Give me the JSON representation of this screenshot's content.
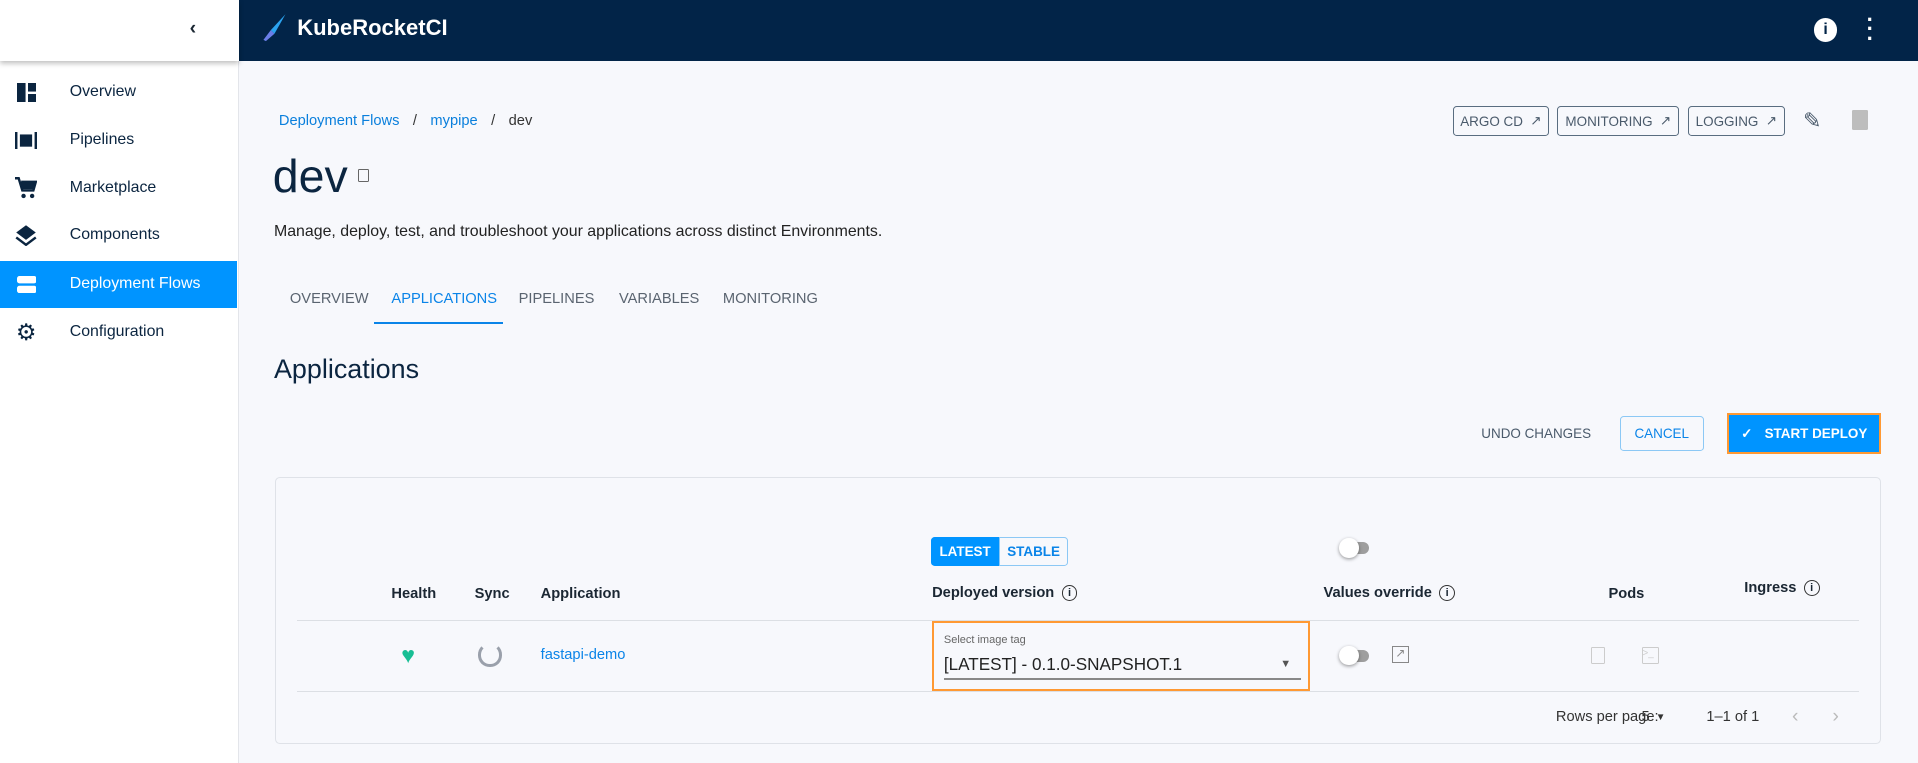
{
  "app": {
    "title": "KubeRocketCI"
  },
  "sidebar": {
    "items": [
      {
        "label": "Overview"
      },
      {
        "label": "Pipelines"
      },
      {
        "label": "Marketplace"
      },
      {
        "label": "Components"
      },
      {
        "label": "Deployment Flows",
        "active": true
      },
      {
        "label": "Configuration"
      }
    ]
  },
  "breadcrumb": [
    "Deployment Flows",
    "mypipe",
    "dev"
  ],
  "actions": {
    "argo": "ARGO CD",
    "monitoring": "MONITORING",
    "logging": "LOGGING"
  },
  "page": {
    "title": "dev",
    "description": "Manage, deploy, test, and troubleshoot your applications across distinct Environments."
  },
  "tabs": [
    "OVERVIEW",
    "APPLICATIONS",
    "PIPELINES",
    "VARIABLES",
    "MONITORING"
  ],
  "section": {
    "title": "Applications",
    "undo": "UNDO CHANGES",
    "cancel": "CANCEL",
    "deploy": "START DEPLOY"
  },
  "table": {
    "toggle": {
      "latest": "LATEST",
      "stable": "STABLE"
    },
    "headers": {
      "health": "Health",
      "sync": "Sync",
      "application": "Application",
      "deployed": "Deployed version",
      "values": "Values override",
      "pods": "Pods",
      "ingress": "Ingress"
    },
    "rows": [
      {
        "application": "fastapi-demo",
        "select_label": "Select image tag",
        "select_value": "[LATEST] - 0.1.0-SNAPSHOT.1"
      }
    ],
    "pagination": {
      "rows_label": "Rows per page:",
      "rows_value": "5",
      "range": "1–1 of 1"
    }
  },
  "colors": {
    "accent": "#0094ff",
    "header": "#022448",
    "highlight": "#ff9933",
    "healthy": "#18be94"
  }
}
